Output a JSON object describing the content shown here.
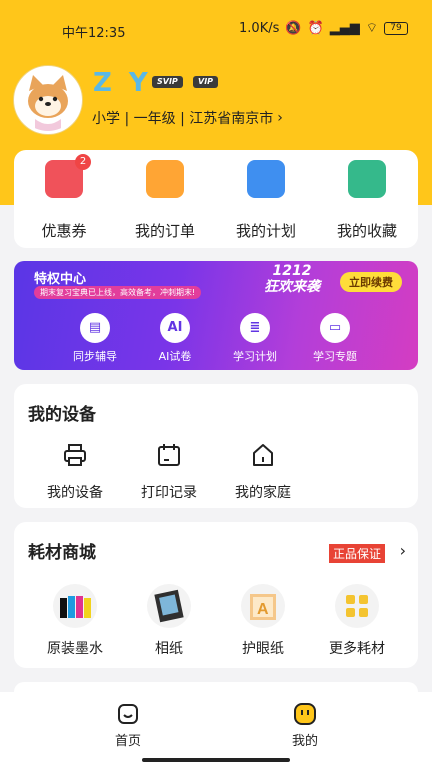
{
  "status_bar": {
    "time": "中午12:35",
    "net_speed": "1.0K/s",
    "battery": "79"
  },
  "profile": {
    "name": "Z Y",
    "badges": [
      "SVIP",
      "VIP"
    ],
    "info": "小学 | 一年级 | 江苏省南京市"
  },
  "quick_actions": [
    {
      "label": "优惠券",
      "badge": "2",
      "icon": "coupon-icon",
      "color": "#f0525a"
    },
    {
      "label": "我的订单",
      "icon": "order-icon",
      "color": "#ffa534"
    },
    {
      "label": "我的计划",
      "icon": "plan-icon",
      "color": "#3f8ff0"
    },
    {
      "label": "我的收藏",
      "icon": "favorite-icon",
      "color": "#35b98b"
    }
  ],
  "privilege": {
    "title": "特权中心",
    "subtitle": "期末复习宝典已上线，高效备考，冲刺期末!",
    "center_text": "1212\n狂欢来袭",
    "renew_label": "立即续费",
    "items": [
      {
        "label": "同步辅导",
        "icon": "book-icon"
      },
      {
        "label": "AI试卷",
        "icon": "ai-icon",
        "glyph": "AI"
      },
      {
        "label": "学习计划",
        "icon": "list-icon"
      },
      {
        "label": "学习专题",
        "icon": "topic-icon"
      }
    ]
  },
  "devices": {
    "title": "我的设备",
    "items": [
      {
        "label": "我的设备",
        "icon": "printer-icon"
      },
      {
        "label": "打印记录",
        "icon": "calendar-icon"
      },
      {
        "label": "我的家庭",
        "icon": "home-icon"
      }
    ]
  },
  "shop": {
    "title": "耗材商城",
    "guarantee": "正品保证",
    "items": [
      {
        "label": "原装墨水",
        "icon": "ink-bottles-icon"
      },
      {
        "label": "相纸",
        "icon": "photo-paper-icon"
      },
      {
        "label": "护眼纸",
        "icon": "eye-care-paper-icon"
      },
      {
        "label": "更多耗材",
        "icon": "more-grid-icon"
      }
    ]
  },
  "tabbar": {
    "tabs": [
      {
        "label": "首页",
        "icon": "home-tab-icon"
      },
      {
        "label": "我的",
        "icon": "me-tab-icon",
        "active": true
      }
    ]
  },
  "colors": {
    "header": "#ffc61a",
    "accent_blue": "#5ab8e6",
    "privilege_gradient_start": "#5a36e6",
    "privilege_gradient_end": "#d43dc2"
  }
}
